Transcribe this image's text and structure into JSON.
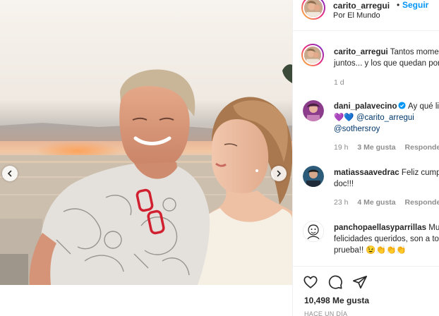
{
  "post": {
    "username": "carito_arregui",
    "separator": "•",
    "follow_label": "Seguir",
    "location": "Por El Mundo"
  },
  "caption": {
    "username": "carito_arregui",
    "line1": "Tantos momentos",
    "line2": "juntos... y los que quedan por vivir",
    "time": "1 d"
  },
  "comments": [
    {
      "username": "dani_palavecino",
      "verified": true,
      "line1": "Ay qué lindos",
      "hearts": "💜💙",
      "mention1": "@carito_arregui",
      "mention2": "@sothersroy",
      "time": "19 h",
      "likes": "3 Me gusta",
      "reply": "Responder"
    },
    {
      "username": "matiassaavedrac",
      "line1": "Feliz cumple",
      "line2": "doc!!!",
      "time": "23 h",
      "likes": "4 Me gusta",
      "reply": "Responder"
    },
    {
      "username": "panchopaellasyparrillas",
      "line1": "Muchas",
      "line2": "felicidades queridos, son a toda",
      "line3": "prueba!!",
      "emojis": "😉👏👏👏"
    }
  ],
  "actions": {
    "likes_count": "10,498 Me gusta",
    "time_ago": "HACE UN DÍA"
  },
  "colors": {
    "accent": "#0095f6",
    "mention": "#00376b",
    "muted": "#8e8e8e",
    "text": "#262626"
  },
  "icons": [
    "chevron-left-icon",
    "chevron-right-icon",
    "heart-icon",
    "comment-icon",
    "share-icon",
    "verified-badge-icon"
  ]
}
